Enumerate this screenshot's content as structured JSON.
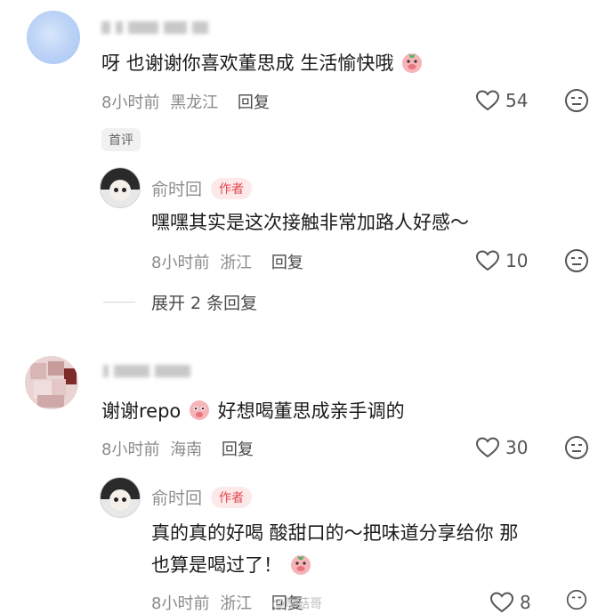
{
  "comments": [
    {
      "text": "呀 也谢谢你喜欢董思成  生活愉快哦",
      "time": "8小时前",
      "location": "黑龙江",
      "reply_label": "回复",
      "likes": "54",
      "badge": "首评"
    },
    {
      "text": "谢谢repo",
      "text_after": "好想喝董思成亲手调的",
      "time": "8小时前",
      "location": "海南",
      "reply_label": "回复",
      "likes": "30"
    }
  ],
  "replies": [
    {
      "name": "俞时回",
      "badge": "作者",
      "text": "嘿嘿其实是这次接触非常加路人好感～",
      "time": "8小时前",
      "location": "浙江",
      "reply_label": "回复",
      "likes": "10"
    },
    {
      "name": "俞时回",
      "badge": "作者",
      "text_line1": "真的真的好喝 酸甜口的～把味道分享给你 那",
      "text_line2": "也算是喝过了！",
      "time": "8小时前",
      "location": "浙江",
      "reply_label": "回复",
      "likes": "8"
    }
  ],
  "expand_replies": "展开 2 条回复",
  "watermark": "@厚菇哥",
  "colors": {
    "accent": "#e4474e",
    "muted": "#8a8a8a"
  },
  "icons": [
    "heart-icon",
    "dislike-face-icon",
    "pig-emoji-icon"
  ]
}
